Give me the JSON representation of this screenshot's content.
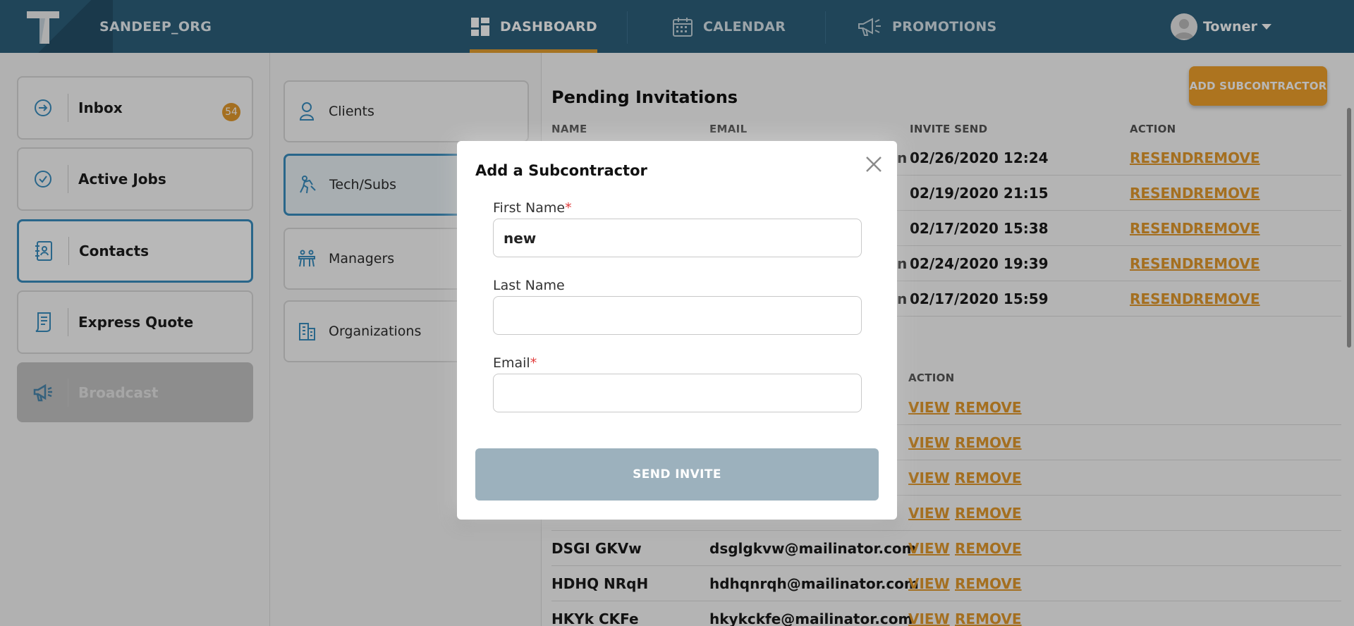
{
  "header": {
    "org_name": "SANDEEP_ORG",
    "nav": [
      {
        "label": "DASHBOARD",
        "icon": "dashboard-icon",
        "active": true
      },
      {
        "label": "CALENDAR",
        "icon": "calendar-icon"
      },
      {
        "label": "PROMOTIONS",
        "icon": "megaphone-icon"
      }
    ],
    "user_name": "Towner"
  },
  "sidebar": {
    "items": [
      {
        "label": "Inbox",
        "icon": "arrow-circle-icon",
        "badge": "54"
      },
      {
        "label": "Active Jobs",
        "icon": "check-circle-icon"
      },
      {
        "label": "Contacts",
        "icon": "address-book-icon",
        "active": true
      },
      {
        "label": "Express Quote",
        "icon": "quote-document-icon"
      },
      {
        "label": "Broadcast",
        "icon": "broadcast-icon",
        "disabled": true
      }
    ]
  },
  "contacts_menu": {
    "items": [
      {
        "label": "Clients",
        "icon": "person-icon"
      },
      {
        "label": "Tech/Subs",
        "icon": "worker-icon",
        "active": true
      },
      {
        "label": "Managers",
        "icon": "meeting-icon"
      },
      {
        "label": "Organizations",
        "icon": "building-icon"
      }
    ]
  },
  "main": {
    "add_button": "ADD SUBCONTRACTOR",
    "pending": {
      "title": "Pending Invitations",
      "columns": [
        "NAME",
        "EMAIL",
        "INVITE SEND",
        "ACTION"
      ],
      "rows": [
        {
          "email_tail": "n",
          "invite_send": "02/26/2020 12:24",
          "resend": "RESEND",
          "remove": "REMOVE"
        },
        {
          "email_tail": "",
          "invite_send": "02/19/2020 21:15",
          "resend": "RESEND",
          "remove": "REMOVE"
        },
        {
          "email_tail": "",
          "invite_send": "02/17/2020 15:38",
          "resend": "RESEND",
          "remove": "REMOVE"
        },
        {
          "email_tail": "n",
          "invite_send": "02/24/2020 19:39",
          "resend": "RESEND",
          "remove": "REMOVE"
        },
        {
          "email_tail": "n",
          "invite_send": "02/17/2020 15:59",
          "resend": "RESEND",
          "remove": "REMOVE"
        }
      ]
    },
    "subs": {
      "action_header": "ACTION",
      "rows": [
        {
          "name": "",
          "email": "",
          "view": "VIEW",
          "remove": "REMOVE"
        },
        {
          "name": "",
          "email": "",
          "view": "VIEW",
          "remove": "REMOVE"
        },
        {
          "name": "",
          "email": "",
          "view": "VIEW",
          "remove": "REMOVE"
        },
        {
          "name": "",
          "email": "",
          "view": "VIEW",
          "remove": "REMOVE"
        },
        {
          "name": "DSGI GKVw",
          "email": "dsglgkvw@mailinator.com",
          "view": "VIEW",
          "remove": "REMOVE"
        },
        {
          "name": "HDHQ NRqH",
          "email": "hdhqnrqh@mailinator.com",
          "view": "VIEW",
          "remove": "REMOVE"
        },
        {
          "name": "HKYk CKFe",
          "email": "hkykckfe@mailinator.com",
          "view": "VIEW",
          "remove": "REMOVE"
        }
      ]
    }
  },
  "modal": {
    "title": "Add a Subcontractor",
    "first_name_label": "First Name",
    "first_name_value": "new",
    "last_name_label": "Last Name",
    "last_name_value": "",
    "email_label": "Email",
    "email_value": "",
    "required_mark": "*",
    "submit_label": "SEND INVITE"
  }
}
